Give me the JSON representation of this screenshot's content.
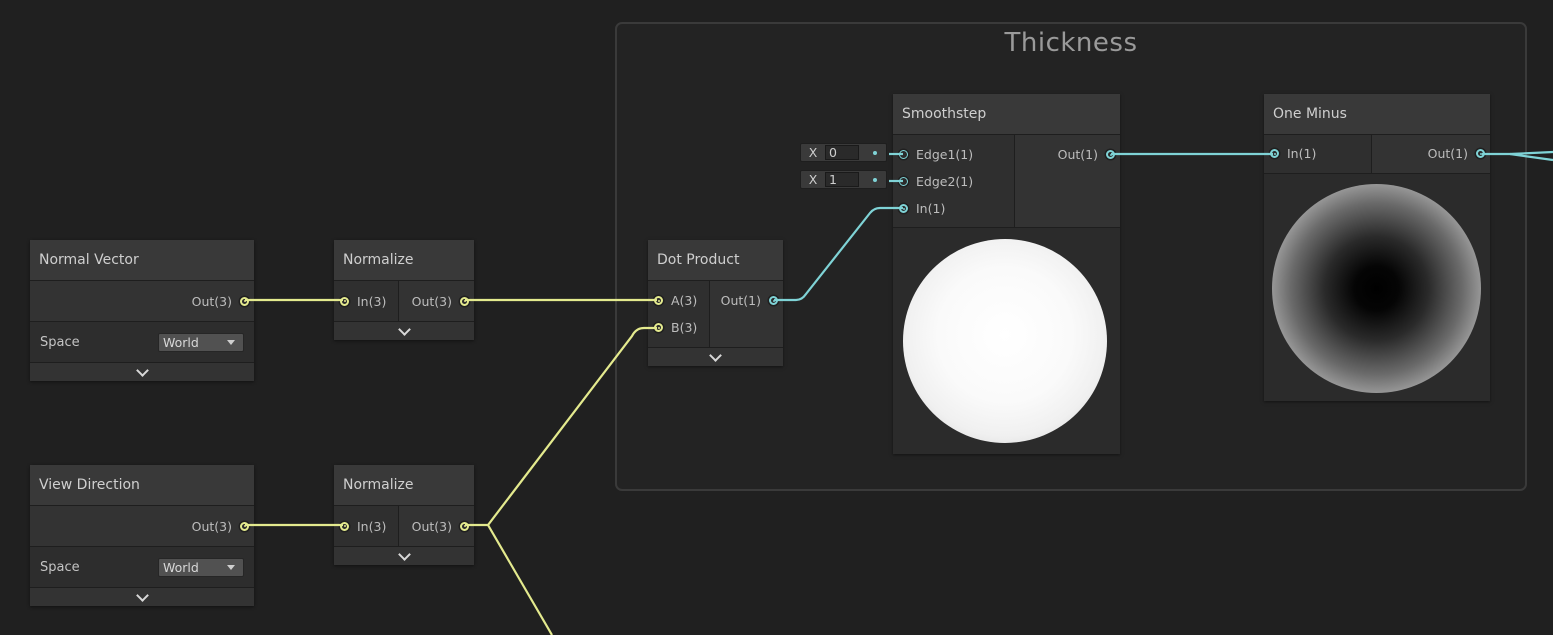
{
  "group": {
    "title": "Thickness"
  },
  "nodes": {
    "normal_vector": {
      "title": "Normal Vector",
      "output": "Out(3)",
      "space_label": "Space",
      "space_value": "World"
    },
    "view_direction": {
      "title": "View Direction",
      "output": "Out(3)",
      "space_label": "Space",
      "space_value": "World"
    },
    "normalize_1": {
      "title": "Normalize",
      "input": "In(3)",
      "output": "Out(3)"
    },
    "normalize_2": {
      "title": "Normalize",
      "input": "In(3)",
      "output": "Out(3)"
    },
    "dot_product": {
      "title": "Dot Product",
      "input_a": "A(3)",
      "input_b": "B(3)",
      "output": "Out(1)"
    },
    "smoothstep": {
      "title": "Smoothstep",
      "input_edge1": "Edge1(1)",
      "input_edge2": "Edge2(1)",
      "input_in": "In(1)",
      "output": "Out(1)",
      "edge1_field": {
        "axis": "X",
        "value": "0"
      },
      "edge2_field": {
        "axis": "X",
        "value": "1"
      }
    },
    "one_minus": {
      "title": "One Minus",
      "input": "In(1)",
      "output": "Out(1)"
    }
  },
  "colors": {
    "vector3_port": "#e4ea8e",
    "float_port": "#7fd3d6",
    "canvas_background": "#202020",
    "node_header": "#393939"
  },
  "icons": {
    "expand": "chevron-down-icon",
    "dropdown": "caret-down-icon"
  }
}
